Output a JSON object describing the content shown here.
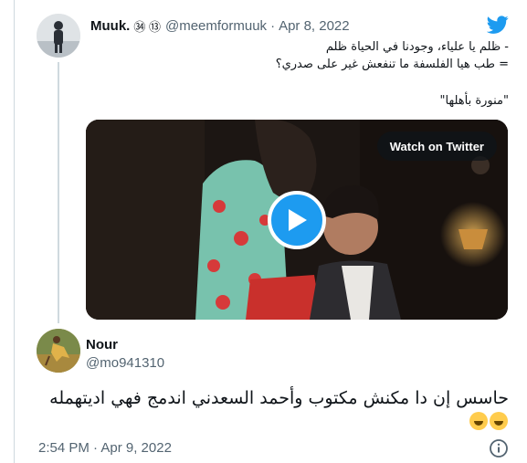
{
  "tweet": {
    "author": {
      "display_name": "Muuk.",
      "badges": "㉞ ⑬",
      "handle": "@meemformuuk",
      "separator": "·",
      "date": "Apr 8, 2022"
    },
    "lines": [
      "- ظلم يا علياء، وجودنا في الحياة ظلم",
      "= طب هيا الفلسفة ما تنفعش غير على صدري؟",
      "\"منورة بأهلها\""
    ],
    "video": {
      "watch_label": "Watch on Twitter"
    }
  },
  "reply": {
    "display_name": "Nour",
    "handle": "@mo941310",
    "text": "حاسس إن دا مكنش مكتوب وأحمد السعدني اندمج فهي اديتهمله",
    "timestamp": "2:54 PM · Apr 9, 2022"
  },
  "colors": {
    "twitter_blue": "#1d9bf0",
    "text_primary": "#0f1419",
    "text_secondary": "#536471",
    "border": "#cfd9de"
  },
  "icons": {
    "brand": "twitter-bird-icon",
    "play": "play-icon",
    "info": "info-icon",
    "emoji": "face-with-tears-of-joy-icon"
  }
}
